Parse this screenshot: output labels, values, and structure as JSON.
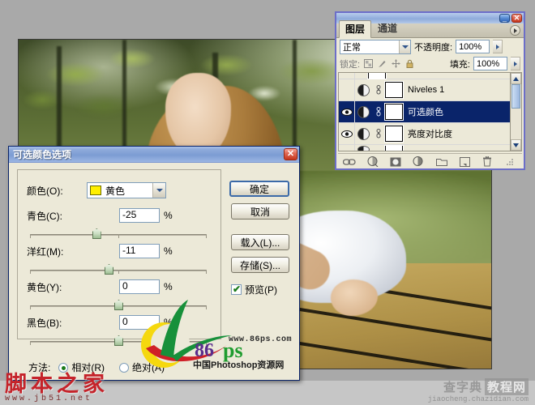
{
  "document": {
    "photo_alt": "woman-lying-on-wooden-deck-photo"
  },
  "selective_color_dialog": {
    "title": "可选颜色选项",
    "close_label": "✕",
    "color_label": "颜色(O):",
    "color_value": "黄色",
    "color_swatch_hex": "#ffef00",
    "sliders": [
      {
        "label": "青色(C):",
        "value": "-25",
        "unit": "%",
        "thumb_pct": 37.5
      },
      {
        "label": "洋红(M):",
        "value": "-11",
        "unit": "%",
        "thumb_pct": 44.5
      },
      {
        "label": "黄色(Y):",
        "value": "0",
        "unit": "%",
        "thumb_pct": 50
      },
      {
        "label": "黑色(B):",
        "value": "0",
        "unit": "%",
        "thumb_pct": 50
      }
    ],
    "buttons": {
      "ok": "确定",
      "cancel": "取消",
      "load": "载入(L)...",
      "save": "存储(S)..."
    },
    "preview_label": "预览(P)",
    "preview_checked": true,
    "method_label": "方法:",
    "method_relative": "相对(R)",
    "method_absolute": "绝对(A)",
    "method_selected": "relative"
  },
  "layers_panel": {
    "minimize_label": "_",
    "close_label": "✕",
    "tabs": [
      {
        "label": "图层",
        "active": true
      },
      {
        "label": "通道",
        "active": false
      }
    ],
    "blend_mode": "正常",
    "opacity_label": "不透明度:",
    "opacity_value": "100%",
    "lock_label": "锁定:",
    "fill_label": "填充:",
    "fill_value": "100%",
    "lock_icons": [
      "transparency-lock-icon",
      "brush-lock-icon",
      "move-lock-icon",
      "all-lock-icon"
    ],
    "layers": [
      {
        "name": "Niveles 1",
        "visible": false,
        "selected": false
      },
      {
        "name": "可选颜色",
        "visible": true,
        "selected": true
      },
      {
        "name": "亮度对比度",
        "visible": true,
        "selected": false
      }
    ],
    "bottom_icons": [
      "link-layers-icon",
      "layer-style-icon",
      "add-mask-icon",
      "new-adjustment-layer-icon",
      "new-group-icon",
      "new-layer-icon",
      "delete-layer-icon"
    ]
  },
  "watermarks": {
    "ps86": {
      "num": "86",
      "ps": "ps",
      "url": "www.86ps.com",
      "cn": "中国Photoshop资源网"
    },
    "jb51": {
      "cn": "脚本之家",
      "url": "www.jb51.net"
    },
    "chazidian": {
      "part1": "查字典",
      "part2": "教程网",
      "url": "jiaocheng.chazidian.com"
    }
  }
}
